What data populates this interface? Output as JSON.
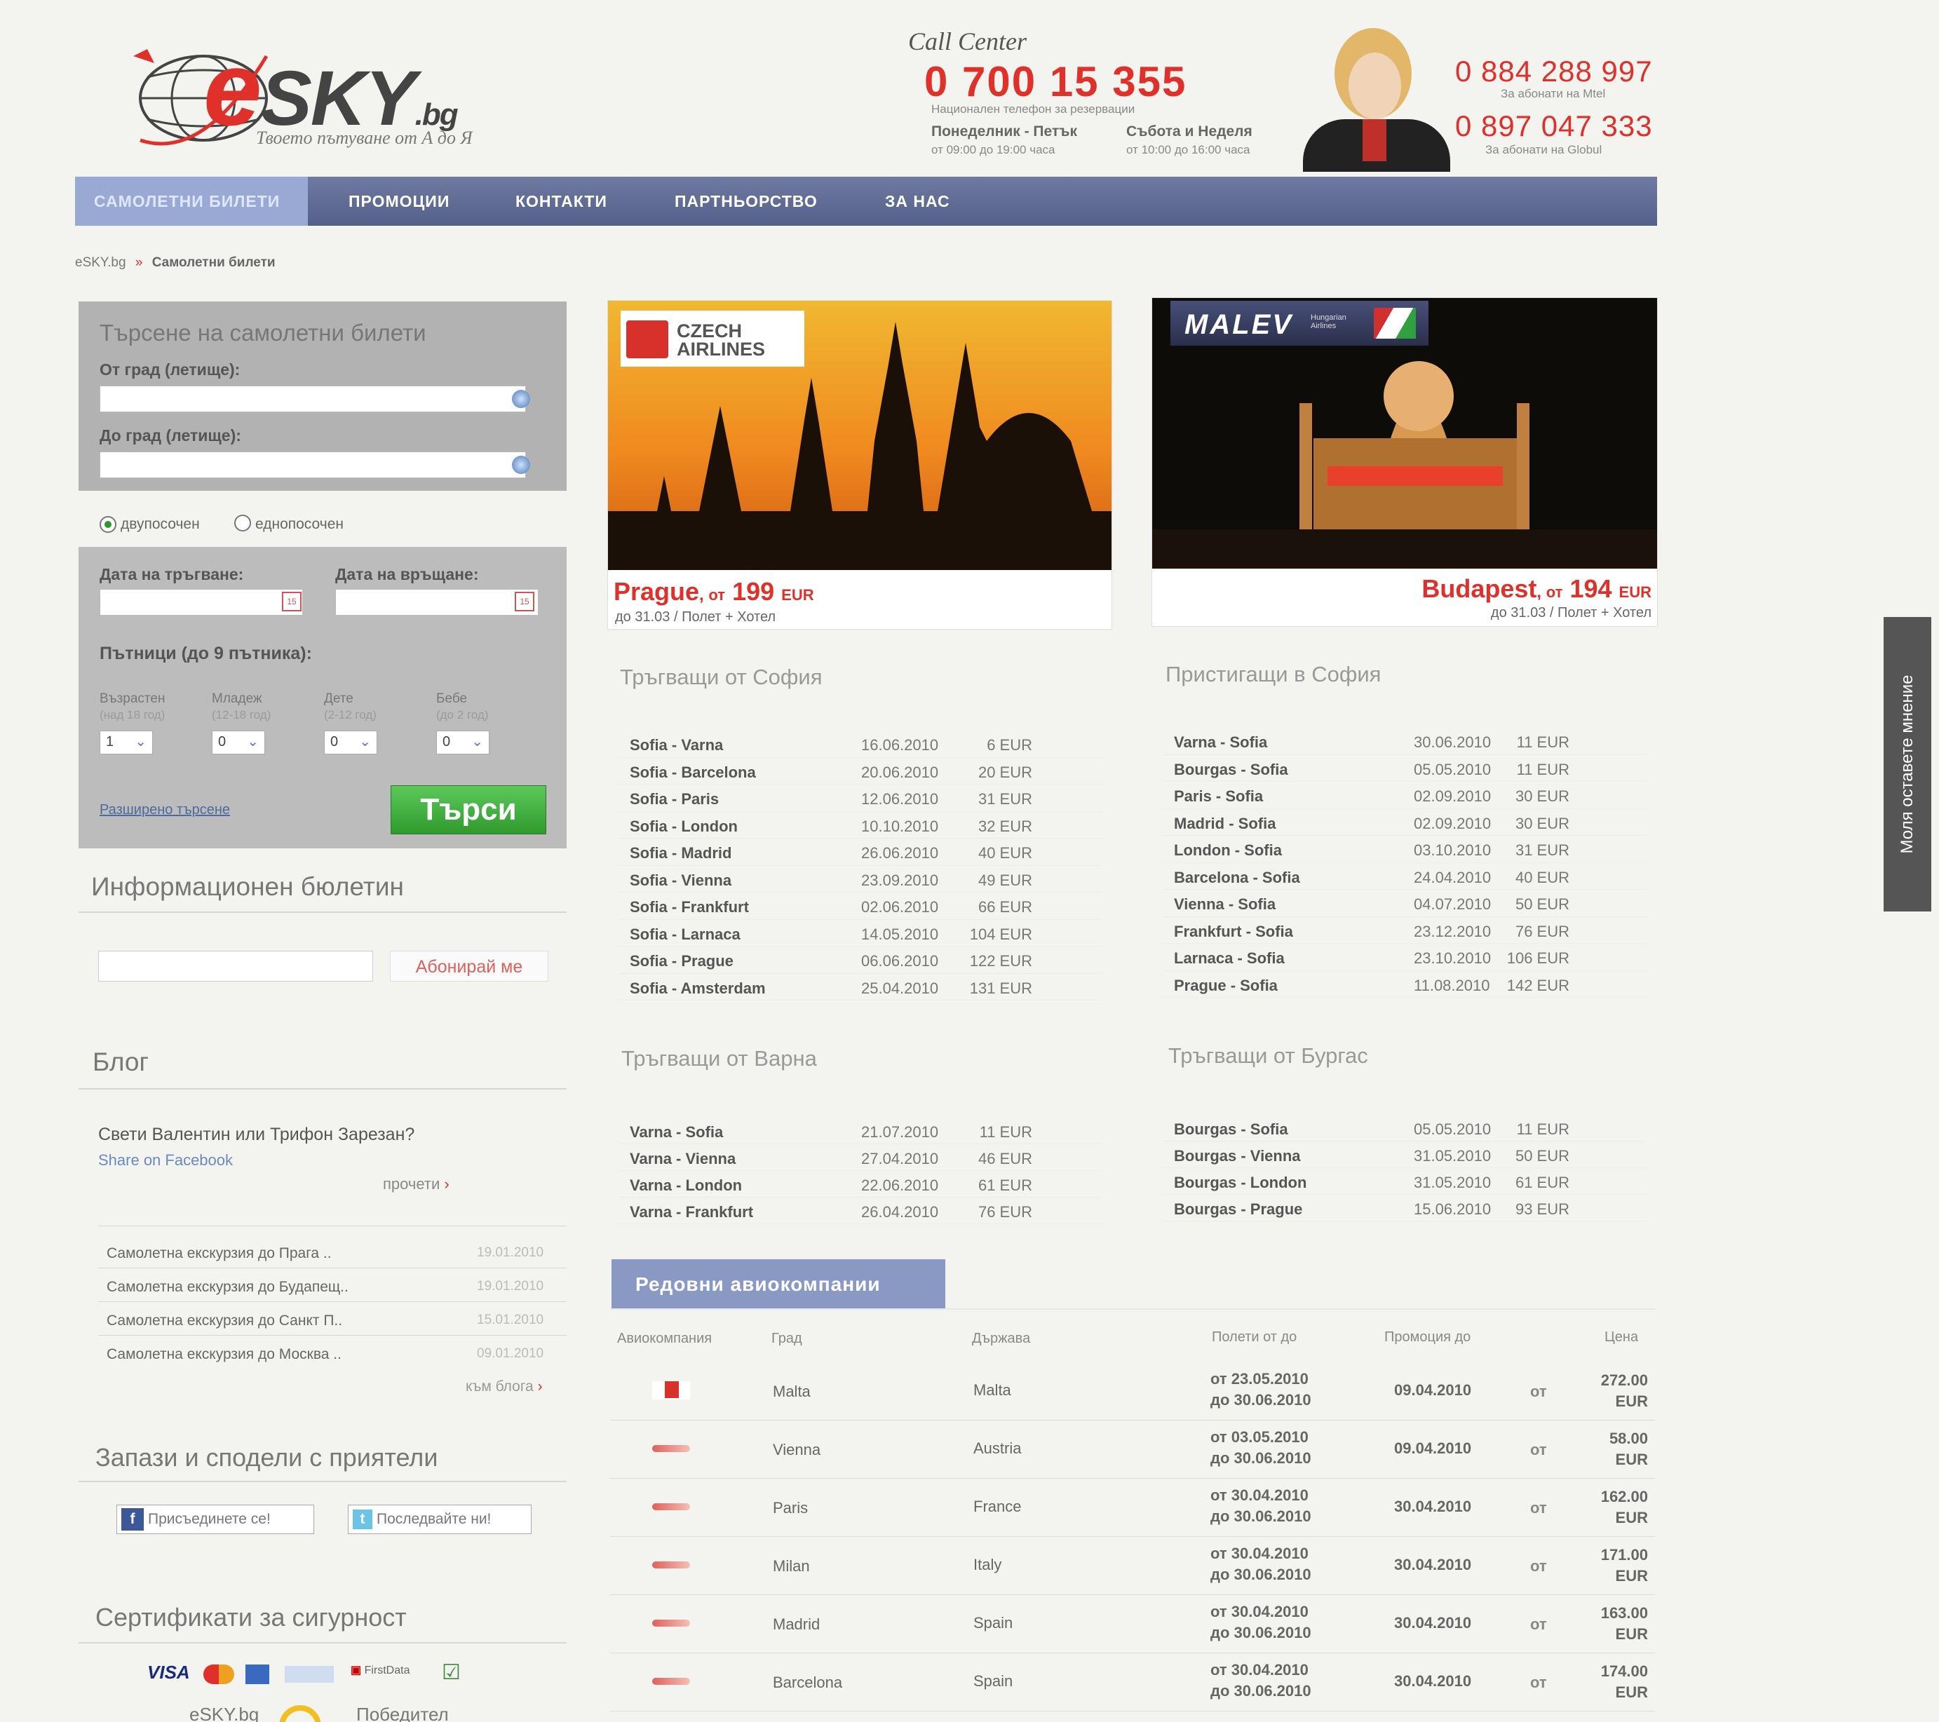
{
  "header": {
    "logo_text": "SKY",
    "logo_e": "e",
    "logo_domain": ".bg",
    "tagline": "Твоето пътуване от А до Я",
    "call_center_label": "Call Center",
    "main_phone": "0 700 15 355",
    "main_phone_note": "Национален телефон за резервации",
    "weekday_label": "Понеделник - Петък",
    "weekday_hours": "от 09:00 до 19:00 часа",
    "weekend_label": "Събота и Неделя",
    "weekend_hours": "от 10:00 до 16:00 часа",
    "mtel_phone": "0 884 288 997",
    "mtel_note": "За абонати на Mtel",
    "globul_phone": "0 897 047 333",
    "globul_note": "За абонати на Globul"
  },
  "nav": [
    {
      "label": "САМОЛЕТНИ БИЛЕТИ",
      "active": true
    },
    {
      "label": "ПРОМОЦИИ"
    },
    {
      "label": "КОНТАКТИ"
    },
    {
      "label": "ПАРТНЬОРСТВО"
    },
    {
      "label": "ЗА НАС"
    }
  ],
  "breadcrumb": {
    "home": "eSKY.bg",
    "separator": "»",
    "current": "Самолетни билети"
  },
  "search": {
    "title": "Търсене на самолетни билети",
    "from_label": "От град (летище):",
    "to_label": "До град (летище):",
    "roundtrip_label": "двупосочен",
    "oneway_label": "еднопосочен",
    "depart_label": "Дата на тръгване:",
    "return_label": "Дата на връщане:",
    "passengers_label": "Пътници (до 9 пътника):",
    "adult_label": "Възрастен",
    "adult_note": "(над 18 год)",
    "adult_value": "1",
    "youth_label": "Младеж",
    "youth_note": "(12-18 год)",
    "youth_value": "0",
    "child_label": "Дете",
    "child_note": "(2-12 год)",
    "child_value": "0",
    "baby_label": "Бебе",
    "baby_note": "(до 2 год)",
    "baby_value": "0",
    "advanced_link": "Разширено търсене",
    "search_button": "Търси"
  },
  "newsletter": {
    "title": "Информационен бюлетин",
    "button": "Абонирай ме"
  },
  "blog": {
    "title": "Блог",
    "post_title": "Свети Валентин или Трифон Зарезан?",
    "share": "Share on Facebook",
    "read_more": "прочети",
    "items": [
      {
        "title": "Самолетна екскурзия до Прага ..",
        "date": "19.01.2010"
      },
      {
        "title": "Самолетна екскурзия до Будапещ..",
        "date": "19.01.2010"
      },
      {
        "title": "Самолетна екскурзия до Санкт П..",
        "date": "15.01.2010"
      },
      {
        "title": "Самолетна екскурзия до Москва ..",
        "date": "09.01.2010"
      }
    ],
    "to_blog": "към блога"
  },
  "social": {
    "title": "Запази и сподели с приятели",
    "facebook": "Присъединете се!",
    "twitter": "Последвайте ни!"
  },
  "security": {
    "title": "Сертификати за сигурност",
    "brands": [
      "VISA",
      "FirstData"
    ],
    "winner_site": "eSKY.bg",
    "winner_label": "Победител"
  },
  "promos": [
    {
      "airline": "CZECH AIRLINES",
      "city": "Prague",
      "from": "от",
      "price": "199",
      "currency": "EUR",
      "sub": "до 31.03 / Полет + Хотел"
    },
    {
      "airline": "MALEV",
      "airline_sub": "Hungarian Airlines",
      "city": "Budapest",
      "from": "от",
      "price": "194",
      "currency": "EUR",
      "sub": "до 31.03 / Полет + Хотел"
    }
  ],
  "routes": {
    "from_sofia": {
      "title": "Тръгващи от София",
      "rows": [
        {
          "route": "Sofia - Varna",
          "date": "16.06.2010",
          "price": "6 EUR"
        },
        {
          "route": "Sofia - Barcelona",
          "date": "20.06.2010",
          "price": "20 EUR"
        },
        {
          "route": "Sofia - Paris",
          "date": "12.06.2010",
          "price": "31 EUR"
        },
        {
          "route": "Sofia - London",
          "date": "10.10.2010",
          "price": "32 EUR"
        },
        {
          "route": "Sofia - Madrid",
          "date": "26.06.2010",
          "price": "40 EUR"
        },
        {
          "route": "Sofia - Vienna",
          "date": "23.09.2010",
          "price": "49 EUR"
        },
        {
          "route": "Sofia - Frankfurt",
          "date": "02.06.2010",
          "price": "66 EUR"
        },
        {
          "route": "Sofia - Larnaca",
          "date": "14.05.2010",
          "price": "104 EUR"
        },
        {
          "route": "Sofia - Prague",
          "date": "06.06.2010",
          "price": "122 EUR"
        },
        {
          "route": "Sofia - Amsterdam",
          "date": "25.04.2010",
          "price": "131 EUR"
        }
      ]
    },
    "to_sofia": {
      "title": "Пристигащи в София",
      "rows": [
        {
          "route": "Varna - Sofia",
          "date": "30.06.2010",
          "price": "11 EUR"
        },
        {
          "route": "Bourgas - Sofia",
          "date": "05.05.2010",
          "price": "11 EUR"
        },
        {
          "route": "Paris - Sofia",
          "date": "02.09.2010",
          "price": "30 EUR"
        },
        {
          "route": "Madrid - Sofia",
          "date": "02.09.2010",
          "price": "30 EUR"
        },
        {
          "route": "London - Sofia",
          "date": "03.10.2010",
          "price": "31 EUR"
        },
        {
          "route": "Barcelona - Sofia",
          "date": "24.04.2010",
          "price": "40 EUR"
        },
        {
          "route": "Vienna - Sofia",
          "date": "04.07.2010",
          "price": "50 EUR"
        },
        {
          "route": "Frankfurt - Sofia",
          "date": "23.12.2010",
          "price": "76 EUR"
        },
        {
          "route": "Larnaca - Sofia",
          "date": "23.10.2010",
          "price": "106 EUR"
        },
        {
          "route": "Prague - Sofia",
          "date": "11.08.2010",
          "price": "142 EUR"
        }
      ]
    },
    "from_varna": {
      "title": "Тръгващи от Варна",
      "rows": [
        {
          "route": "Varna - Sofia",
          "date": "21.07.2010",
          "price": "11 EUR"
        },
        {
          "route": "Varna - Vienna",
          "date": "27.04.2010",
          "price": "46 EUR"
        },
        {
          "route": "Varna - London",
          "date": "22.06.2010",
          "price": "61 EUR"
        },
        {
          "route": "Varna - Frankfurt",
          "date": "26.04.2010",
          "price": "76 EUR"
        }
      ]
    },
    "from_bourgas": {
      "title": "Тръгващи от Бургас",
      "rows": [
        {
          "route": "Bourgas - Sofia",
          "date": "05.05.2010",
          "price": "11 EUR"
        },
        {
          "route": "Bourgas - Vienna",
          "date": "31.05.2010",
          "price": "50 EUR"
        },
        {
          "route": "Bourgas - London",
          "date": "31.05.2010",
          "price": "61 EUR"
        },
        {
          "route": "Bourgas - Prague",
          "date": "15.06.2010",
          "price": "93 EUR"
        }
      ]
    }
  },
  "airlines_table": {
    "tab": "Редовни авиокомпании",
    "headers": {
      "airline": "Авиокомпания",
      "city": "Град",
      "country": "Държава",
      "flights": "Полети от до",
      "promo": "Промоция до",
      "price": "Цена"
    },
    "rows": [
      {
        "city": "Malta",
        "country": "Malta",
        "from": "от 23.05.2010",
        "to": "до 30.06.2010",
        "promo": "09.04.2010",
        "ot": "от",
        "price": "272.00",
        "currency": "EUR"
      },
      {
        "city": "Vienna",
        "country": "Austria",
        "from": "от 03.05.2010",
        "to": "до 30.06.2010",
        "promo": "09.04.2010",
        "ot": "от",
        "price": "58.00",
        "currency": "EUR"
      },
      {
        "city": "Paris",
        "country": "France",
        "from": "от 30.04.2010",
        "to": "до 30.06.2010",
        "promo": "30.04.2010",
        "ot": "от",
        "price": "162.00",
        "currency": "EUR"
      },
      {
        "city": "Milan",
        "country": "Italy",
        "from": "от 30.04.2010",
        "to": "до 30.06.2010",
        "promo": "30.04.2010",
        "ot": "от",
        "price": "171.00",
        "currency": "EUR"
      },
      {
        "city": "Madrid",
        "country": "Spain",
        "from": "от 30.04.2010",
        "to": "до 30.06.2010",
        "promo": "30.04.2010",
        "ot": "от",
        "price": "163.00",
        "currency": "EUR"
      },
      {
        "city": "Barcelona",
        "country": "Spain",
        "from": "от 30.04.2010",
        "to": "до 30.06.2010",
        "promo": "30.04.2010",
        "ot": "от",
        "price": "174.00",
        "currency": "EUR"
      }
    ]
  },
  "feedback_tab": "Моля оставете мнение",
  "colors": {
    "brand_red": "#e0302a",
    "nav": "#5c6890",
    "nav_active": "#9aa8d4",
    "search_green": "#3aaa38"
  }
}
